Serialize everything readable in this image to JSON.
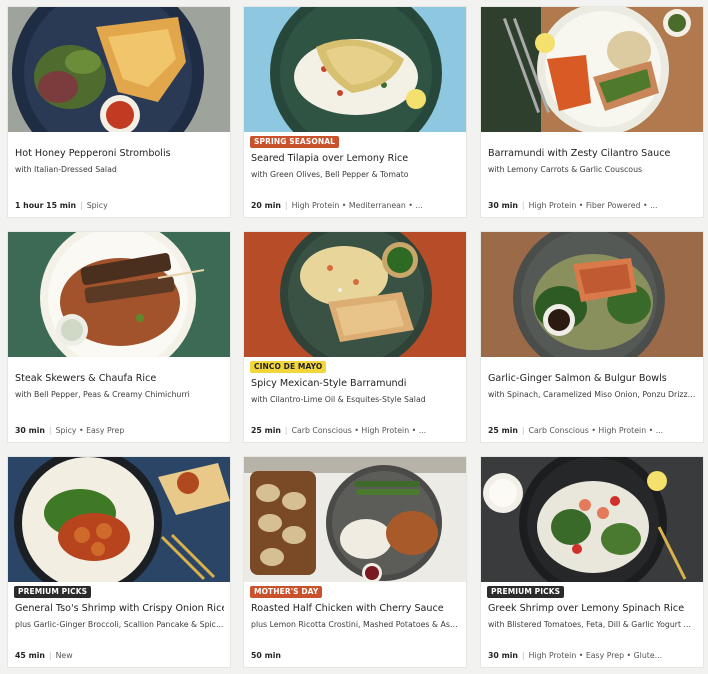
{
  "cards": [
    {
      "badge": "",
      "title": "Hot Honey Pepperoni Strombolis",
      "subtitle": "with Italian-Dressed Salad",
      "time": "1 hour 15 min",
      "tags": "Spicy"
    },
    {
      "badge": "SPRING SEASONAL",
      "badge_color": "#c9512b",
      "title": "Seared Tilapia over Lemony Rice",
      "subtitle": "with Green Olives, Bell Pepper & Tomato",
      "time": "20 min",
      "tags": "High Protein • Mediterranean • ..."
    },
    {
      "badge": "",
      "title": "Barramundi with Zesty Cilantro Sauce",
      "subtitle": "with Lemony Carrots & Garlic Couscous",
      "time": "30 min",
      "tags": "High Protein • Fiber Powered • ..."
    },
    {
      "badge": "",
      "title": "Steak Skewers & Chaufa Rice",
      "subtitle": "with Bell Pepper, Peas & Creamy Chimichurri",
      "time": "30 min",
      "tags": "Spicy • Easy Prep"
    },
    {
      "badge": "CINCO DE MAYO",
      "badge_color": "#f2d63c",
      "title": "Spicy Mexican-Style Barramundi",
      "subtitle": "with Cilantro-Lime Oil & Esquites-Style Salad",
      "time": "25 min",
      "tags": "Carb Conscious • High Protein • ..."
    },
    {
      "badge": "",
      "title": "Garlic-Ginger Salmon & Bulgur Bowls",
      "subtitle": "with Spinach, Caramelized Miso Onion, Ponzu Drizzl...",
      "time": "25 min",
      "tags": "Carb Conscious • High Protein • ..."
    },
    {
      "badge": "PREMIUM PICKS",
      "badge_color": "#2b2b2b",
      "title": "General Tso's Shrimp with Crispy Onion Rice",
      "subtitle": "plus Garlic-Ginger Broccoli, Scallion Pancake & Spic...",
      "time": "45 min",
      "tags": "New"
    },
    {
      "badge": "MOTHER'S DAY",
      "badge_color": "#c9512b",
      "title": "Roasted Half Chicken with Cherry Sauce",
      "subtitle": "plus Lemon Ricotta Crostini, Mashed Potatoes & Asp...",
      "time": "50 min",
      "tags": ""
    },
    {
      "badge": "PREMIUM PICKS",
      "badge_color": "#2b2b2b",
      "title": "Greek Shrimp over Lemony Spinach Rice",
      "subtitle": "with Blistered Tomatoes, Feta, Dill & Garlic Yogurt ...",
      "time": "30 min",
      "tags": "High Protein • Easy Prep • Glute..."
    }
  ],
  "separator": "|"
}
